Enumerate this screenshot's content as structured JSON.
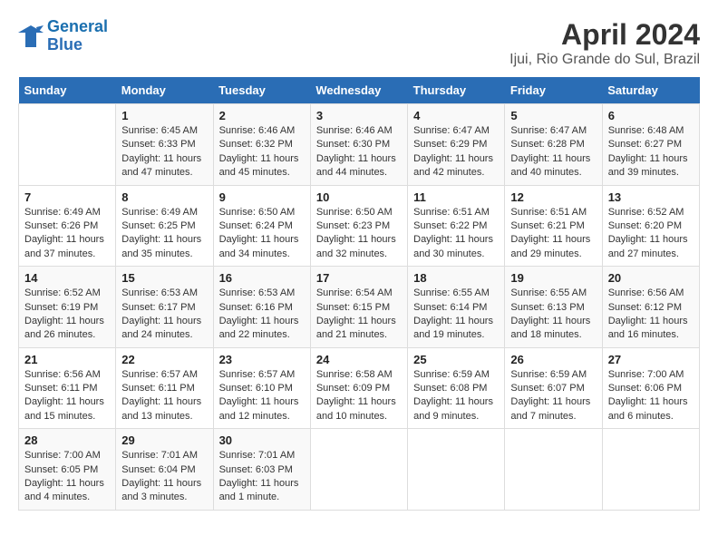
{
  "header": {
    "logo_line1": "General",
    "logo_line2": "Blue",
    "title": "April 2024",
    "subtitle": "Ijui, Rio Grande do Sul, Brazil"
  },
  "columns": [
    "Sunday",
    "Monday",
    "Tuesday",
    "Wednesday",
    "Thursday",
    "Friday",
    "Saturday"
  ],
  "weeks": [
    [
      {
        "num": "",
        "info": ""
      },
      {
        "num": "1",
        "info": "Sunrise: 6:45 AM\nSunset: 6:33 PM\nDaylight: 11 hours\nand 47 minutes."
      },
      {
        "num": "2",
        "info": "Sunrise: 6:46 AM\nSunset: 6:32 PM\nDaylight: 11 hours\nand 45 minutes."
      },
      {
        "num": "3",
        "info": "Sunrise: 6:46 AM\nSunset: 6:30 PM\nDaylight: 11 hours\nand 44 minutes."
      },
      {
        "num": "4",
        "info": "Sunrise: 6:47 AM\nSunset: 6:29 PM\nDaylight: 11 hours\nand 42 minutes."
      },
      {
        "num": "5",
        "info": "Sunrise: 6:47 AM\nSunset: 6:28 PM\nDaylight: 11 hours\nand 40 minutes."
      },
      {
        "num": "6",
        "info": "Sunrise: 6:48 AM\nSunset: 6:27 PM\nDaylight: 11 hours\nand 39 minutes."
      }
    ],
    [
      {
        "num": "7",
        "info": "Sunrise: 6:49 AM\nSunset: 6:26 PM\nDaylight: 11 hours\nand 37 minutes."
      },
      {
        "num": "8",
        "info": "Sunrise: 6:49 AM\nSunset: 6:25 PM\nDaylight: 11 hours\nand 35 minutes."
      },
      {
        "num": "9",
        "info": "Sunrise: 6:50 AM\nSunset: 6:24 PM\nDaylight: 11 hours\nand 34 minutes."
      },
      {
        "num": "10",
        "info": "Sunrise: 6:50 AM\nSunset: 6:23 PM\nDaylight: 11 hours\nand 32 minutes."
      },
      {
        "num": "11",
        "info": "Sunrise: 6:51 AM\nSunset: 6:22 PM\nDaylight: 11 hours\nand 30 minutes."
      },
      {
        "num": "12",
        "info": "Sunrise: 6:51 AM\nSunset: 6:21 PM\nDaylight: 11 hours\nand 29 minutes."
      },
      {
        "num": "13",
        "info": "Sunrise: 6:52 AM\nSunset: 6:20 PM\nDaylight: 11 hours\nand 27 minutes."
      }
    ],
    [
      {
        "num": "14",
        "info": "Sunrise: 6:52 AM\nSunset: 6:19 PM\nDaylight: 11 hours\nand 26 minutes."
      },
      {
        "num": "15",
        "info": "Sunrise: 6:53 AM\nSunset: 6:17 PM\nDaylight: 11 hours\nand 24 minutes."
      },
      {
        "num": "16",
        "info": "Sunrise: 6:53 AM\nSunset: 6:16 PM\nDaylight: 11 hours\nand 22 minutes."
      },
      {
        "num": "17",
        "info": "Sunrise: 6:54 AM\nSunset: 6:15 PM\nDaylight: 11 hours\nand 21 minutes."
      },
      {
        "num": "18",
        "info": "Sunrise: 6:55 AM\nSunset: 6:14 PM\nDaylight: 11 hours\nand 19 minutes."
      },
      {
        "num": "19",
        "info": "Sunrise: 6:55 AM\nSunset: 6:13 PM\nDaylight: 11 hours\nand 18 minutes."
      },
      {
        "num": "20",
        "info": "Sunrise: 6:56 AM\nSunset: 6:12 PM\nDaylight: 11 hours\nand 16 minutes."
      }
    ],
    [
      {
        "num": "21",
        "info": "Sunrise: 6:56 AM\nSunset: 6:11 PM\nDaylight: 11 hours\nand 15 minutes."
      },
      {
        "num": "22",
        "info": "Sunrise: 6:57 AM\nSunset: 6:11 PM\nDaylight: 11 hours\nand 13 minutes."
      },
      {
        "num": "23",
        "info": "Sunrise: 6:57 AM\nSunset: 6:10 PM\nDaylight: 11 hours\nand 12 minutes."
      },
      {
        "num": "24",
        "info": "Sunrise: 6:58 AM\nSunset: 6:09 PM\nDaylight: 11 hours\nand 10 minutes."
      },
      {
        "num": "25",
        "info": "Sunrise: 6:59 AM\nSunset: 6:08 PM\nDaylight: 11 hours\nand 9 minutes."
      },
      {
        "num": "26",
        "info": "Sunrise: 6:59 AM\nSunset: 6:07 PM\nDaylight: 11 hours\nand 7 minutes."
      },
      {
        "num": "27",
        "info": "Sunrise: 7:00 AM\nSunset: 6:06 PM\nDaylight: 11 hours\nand 6 minutes."
      }
    ],
    [
      {
        "num": "28",
        "info": "Sunrise: 7:00 AM\nSunset: 6:05 PM\nDaylight: 11 hours\nand 4 minutes."
      },
      {
        "num": "29",
        "info": "Sunrise: 7:01 AM\nSunset: 6:04 PM\nDaylight: 11 hours\nand 3 minutes."
      },
      {
        "num": "30",
        "info": "Sunrise: 7:01 AM\nSunset: 6:03 PM\nDaylight: 11 hours\nand 1 minute."
      },
      {
        "num": "",
        "info": ""
      },
      {
        "num": "",
        "info": ""
      },
      {
        "num": "",
        "info": ""
      },
      {
        "num": "",
        "info": ""
      }
    ]
  ]
}
